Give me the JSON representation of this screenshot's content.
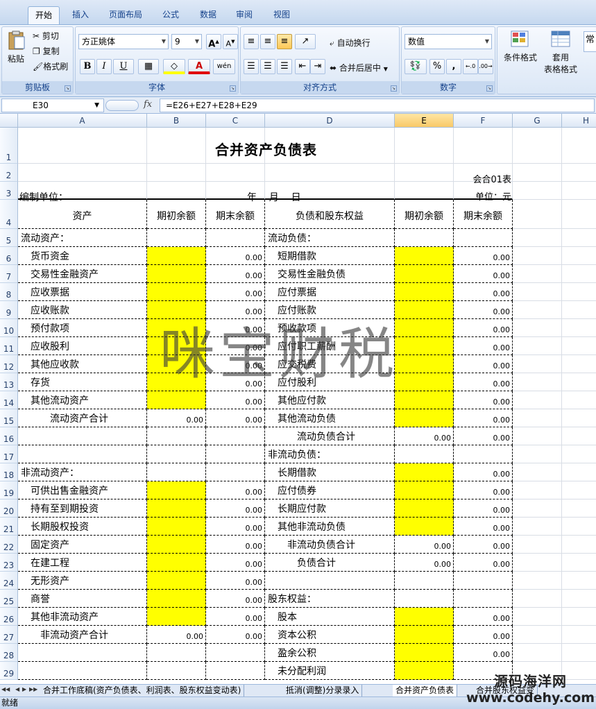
{
  "ribbon": {
    "tabs": [
      "开始",
      "插入",
      "页面布局",
      "公式",
      "数据",
      "审阅",
      "视图"
    ],
    "clipboard": {
      "paste": "粘贴",
      "cut": "剪切",
      "copy": "复制",
      "format_painter": "格式刷",
      "label": "剪贴板"
    },
    "font": {
      "name": "方正姚体",
      "size": "9",
      "grow": "A",
      "shrink": "A",
      "bold": "B",
      "italic": "I",
      "underline": "U",
      "fill_symbol": "◇",
      "color_symbol": "A",
      "phonetic": "wén",
      "label": "字体"
    },
    "alignment": {
      "wrap": "自动换行",
      "merge": "合并后居中",
      "label": "对齐方式"
    },
    "number": {
      "format": "数值",
      "percent": "%",
      "comma": ",",
      "label": "数字"
    },
    "styles": {
      "conditional": "条件格式",
      "table_1": "套用",
      "table_2": "表格格式",
      "cell_styles": "常"
    }
  },
  "formula_bar": {
    "cell_ref": "E30",
    "fx": "fx",
    "formula": "=E26+E27+E28+E29"
  },
  "columns": [
    "A",
    "B",
    "C",
    "D",
    "E",
    "F",
    "G",
    "H"
  ],
  "sheet": {
    "title": "合并资产负债表",
    "form_no": "会合01表",
    "unit_label": "编制单位：",
    "date_label": "年    月    日",
    "currency": "单位：元",
    "headers": {
      "assets": "资产",
      "opening_a": "期初余额",
      "closing_a": "期末余额",
      "liabilities": "负债和股东权益",
      "opening_l": "期初余额",
      "closing_l": "期末余额"
    },
    "rows": [
      {
        "r": "5",
        "a": "流动资产：",
        "ai": 0,
        "b": "",
        "by": false,
        "c": "",
        "d": "流动负债：",
        "di": 0,
        "e": "",
        "ey": false,
        "f": ""
      },
      {
        "r": "6",
        "a": "货币资金",
        "ai": 1,
        "b": "",
        "by": true,
        "c": "0.00",
        "d": "短期借款",
        "di": 1,
        "e": "",
        "ey": true,
        "f": "0.00"
      },
      {
        "r": "7",
        "a": "交易性金融资产",
        "ai": 1,
        "b": "",
        "by": true,
        "c": "0.00",
        "d": "交易性金融负债",
        "di": 1,
        "e": "",
        "ey": true,
        "f": "0.00"
      },
      {
        "r": "8",
        "a": "应收票据",
        "ai": 1,
        "b": "",
        "by": true,
        "c": "0.00",
        "d": "应付票据",
        "di": 1,
        "e": "",
        "ey": true,
        "f": "0.00"
      },
      {
        "r": "9",
        "a": "应收账款",
        "ai": 1,
        "b": "",
        "by": true,
        "c": "0.00",
        "d": "应付账款",
        "di": 1,
        "e": "",
        "ey": true,
        "f": "0.00"
      },
      {
        "r": "10",
        "a": "预付款项",
        "ai": 1,
        "b": "",
        "by": true,
        "c": "0.00",
        "d": "预收款项",
        "di": 1,
        "e": "",
        "ey": true,
        "f": "0.00"
      },
      {
        "r": "11",
        "a": "应收股利",
        "ai": 1,
        "b": "",
        "by": true,
        "c": "0.00",
        "d": "应付职工薪酬",
        "di": 1,
        "e": "",
        "ey": true,
        "f": "0.00"
      },
      {
        "r": "12",
        "a": "其他应收款",
        "ai": 1,
        "b": "",
        "by": true,
        "c": "0.00",
        "d": "应交税费",
        "di": 1,
        "e": "",
        "ey": true,
        "f": "0.00"
      },
      {
        "r": "13",
        "a": "存货",
        "ai": 1,
        "b": "",
        "by": true,
        "c": "0.00",
        "d": "应付股利",
        "di": 1,
        "e": "",
        "ey": true,
        "f": "0.00"
      },
      {
        "r": "14",
        "a": "其他流动资产",
        "ai": 1,
        "b": "",
        "by": true,
        "c": "0.00",
        "d": "其他应付款",
        "di": 1,
        "e": "",
        "ey": true,
        "f": "0.00"
      },
      {
        "r": "15",
        "a": "流动资产合计",
        "ai": 3,
        "b": "0.00",
        "by": false,
        "c": "0.00",
        "d": "其他流动负债",
        "di": 1,
        "e": "",
        "ey": true,
        "f": "0.00"
      },
      {
        "r": "16",
        "a": "",
        "ai": 0,
        "b": "",
        "by": false,
        "c": "",
        "d": "流动负债合计",
        "di": 3,
        "e": "0.00",
        "ey": false,
        "f": "0.00"
      },
      {
        "r": "17",
        "a": "",
        "ai": 0,
        "b": "",
        "by": false,
        "c": "",
        "d": "非流动负债：",
        "di": 0,
        "e": "",
        "ey": false,
        "f": ""
      },
      {
        "r": "18",
        "a": "非流动资产：",
        "ai": 0,
        "b": "",
        "by": false,
        "c": "",
        "d": "长期借款",
        "di": 1,
        "e": "",
        "ey": true,
        "f": "0.00"
      },
      {
        "r": "19",
        "a": "可供出售金融资产",
        "ai": 1,
        "b": "",
        "by": true,
        "c": "0.00",
        "d": "应付债券",
        "di": 1,
        "e": "",
        "ey": true,
        "f": "0.00"
      },
      {
        "r": "20",
        "a": "持有至到期投资",
        "ai": 1,
        "b": "",
        "by": true,
        "c": "0.00",
        "d": "长期应付款",
        "di": 1,
        "e": "",
        "ey": true,
        "f": "0.00"
      },
      {
        "r": "21",
        "a": "长期股权投资",
        "ai": 1,
        "b": "",
        "by": true,
        "c": "0.00",
        "d": "其他非流动负债",
        "di": 1,
        "e": "",
        "ey": true,
        "f": "0.00"
      },
      {
        "r": "22",
        "a": "固定资产",
        "ai": 1,
        "b": "",
        "by": true,
        "c": "0.00",
        "d": "非流动负债合计",
        "di": 2,
        "e": "0.00",
        "ey": false,
        "f": "0.00"
      },
      {
        "r": "23",
        "a": "在建工程",
        "ai": 1,
        "b": "",
        "by": true,
        "c": "0.00",
        "d": "负债合计",
        "di": 3,
        "e": "0.00",
        "ey": false,
        "f": "0.00"
      },
      {
        "r": "24",
        "a": "无形资产",
        "ai": 1,
        "b": "",
        "by": true,
        "c": "0.00",
        "d": "",
        "di": 0,
        "e": "",
        "ey": false,
        "f": ""
      },
      {
        "r": "25",
        "a": "商誉",
        "ai": 1,
        "b": "",
        "by": true,
        "c": "0.00",
        "d": "股东权益：",
        "di": 0,
        "e": "",
        "ey": false,
        "f": ""
      },
      {
        "r": "26",
        "a": "其他非流动资产",
        "ai": 1,
        "b": "",
        "by": true,
        "c": "0.00",
        "d": "股本",
        "di": 1,
        "e": "",
        "ey": true,
        "f": "0.00"
      },
      {
        "r": "27",
        "a": "非流动资产合计",
        "ai": 2,
        "b": "0.00",
        "by": false,
        "c": "0.00",
        "d": "资本公积",
        "di": 1,
        "e": "",
        "ey": true,
        "f": "0.00"
      },
      {
        "r": "28",
        "a": "",
        "ai": 0,
        "b": "",
        "by": false,
        "c": "",
        "d": "盈余公积",
        "di": 1,
        "e": "",
        "ey": true,
        "f": "0.00"
      },
      {
        "r": "29",
        "a": "",
        "ai": 0,
        "b": "",
        "by": false,
        "c": "",
        "d": "未分配利润",
        "di": 1,
        "e": "",
        "ey": true,
        "f": ""
      }
    ]
  },
  "watermark": "咪宝财税",
  "sheet_tabs": [
    {
      "label": "合并工作底稿(资产负债表、利润表、股东权益变动表)",
      "active": false
    },
    {
      "label": "抵消(调整)分录录入",
      "active": false
    },
    {
      "label": "合并资产负债表",
      "active": true
    },
    {
      "label": "合并股东权益变",
      "active": false
    }
  ],
  "status": {
    "ready": "就绪"
  },
  "brand": {
    "line1": "源码海洋网",
    "line2": "www.codehy.com"
  },
  "colors": {
    "input_cell": "#ffff00",
    "ribbon": "#dbe7f6",
    "selected_column": "#f8c968"
  }
}
